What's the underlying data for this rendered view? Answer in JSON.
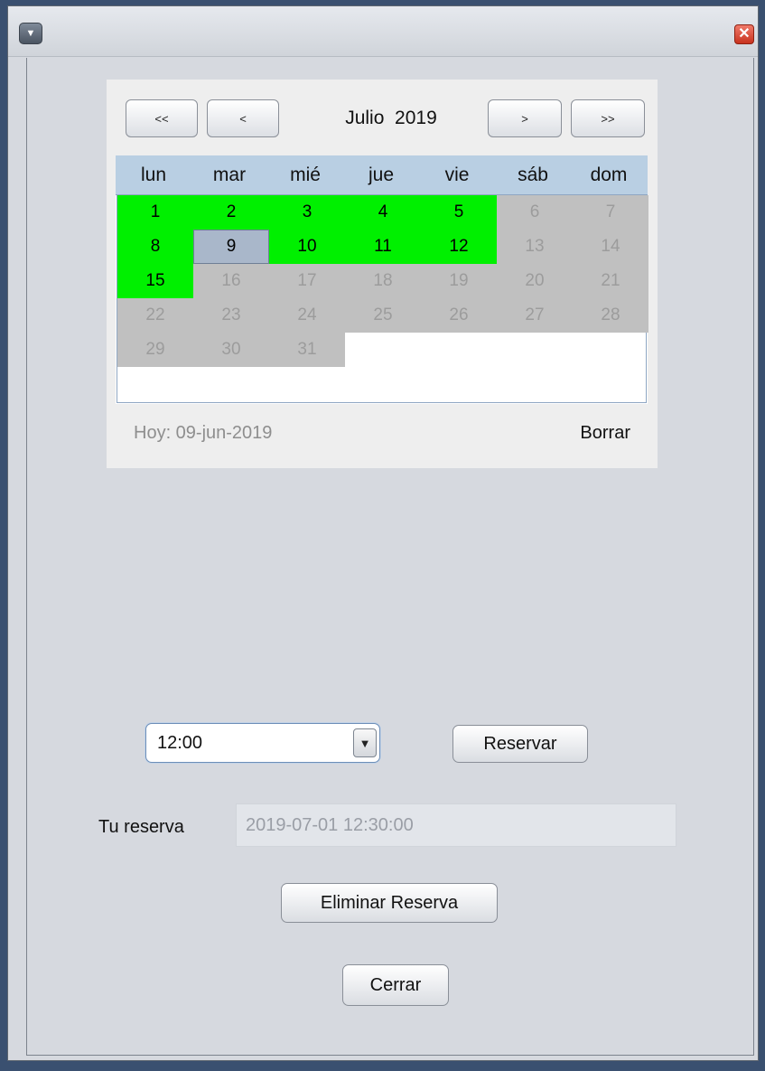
{
  "window": {
    "menu_icon": "down-triangle",
    "close_icon": "x"
  },
  "calendar": {
    "nav_first": "<<",
    "nav_prev": "<",
    "month_title": "Julio  2019",
    "nav_next": ">",
    "nav_last": ">>",
    "weekdays": [
      "lun",
      "mar",
      "mié",
      "jue",
      "vie",
      "sáb",
      "dom"
    ],
    "days": [
      {
        "label": "1",
        "state": "available"
      },
      {
        "label": "2",
        "state": "available"
      },
      {
        "label": "3",
        "state": "available"
      },
      {
        "label": "4",
        "state": "available"
      },
      {
        "label": "5",
        "state": "available"
      },
      {
        "label": "6",
        "state": "disabled"
      },
      {
        "label": "7",
        "state": "disabled"
      },
      {
        "label": "8",
        "state": "available"
      },
      {
        "label": "9",
        "state": "selected"
      },
      {
        "label": "10",
        "state": "available"
      },
      {
        "label": "11",
        "state": "available"
      },
      {
        "label": "12",
        "state": "available"
      },
      {
        "label": "13",
        "state": "disabled"
      },
      {
        "label": "14",
        "state": "disabled"
      },
      {
        "label": "15",
        "state": "available"
      },
      {
        "label": "16",
        "state": "disabled"
      },
      {
        "label": "17",
        "state": "disabled"
      },
      {
        "label": "18",
        "state": "disabled"
      },
      {
        "label": "19",
        "state": "disabled"
      },
      {
        "label": "20",
        "state": "disabled"
      },
      {
        "label": "21",
        "state": "disabled"
      },
      {
        "label": "22",
        "state": "disabled"
      },
      {
        "label": "23",
        "state": "disabled"
      },
      {
        "label": "24",
        "state": "disabled"
      },
      {
        "label": "25",
        "state": "disabled"
      },
      {
        "label": "26",
        "state": "disabled"
      },
      {
        "label": "27",
        "state": "disabled"
      },
      {
        "label": "28",
        "state": "disabled"
      },
      {
        "label": "29",
        "state": "disabled"
      },
      {
        "label": "30",
        "state": "disabled"
      },
      {
        "label": "31",
        "state": "disabled"
      }
    ],
    "today_label": "Hoy:  09-jun-2019",
    "clear_label": "Borrar",
    "colors": {
      "available": "#00f000",
      "disabled": "#c0c0c0",
      "selected": "#a9b7ca",
      "header": "#b9cfe3"
    }
  },
  "booking": {
    "time_value": "12:00",
    "time_dropdown_icon": "down-triangle",
    "reserve_label": "Reservar",
    "your_booking_label": "Tu reserva",
    "your_booking_value": "2019-07-01 12:30:00",
    "delete_label": "Eliminar Reserva",
    "close_label": "Cerrar"
  }
}
